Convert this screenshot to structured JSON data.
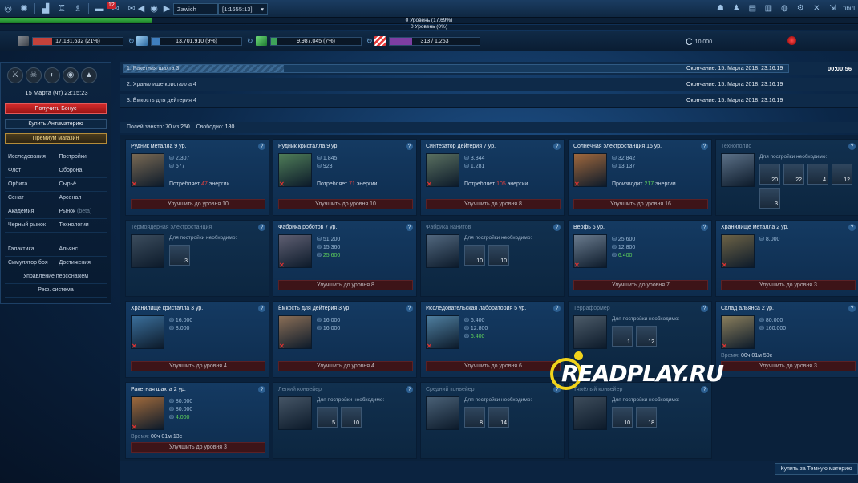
{
  "topbar": {
    "icons": [
      "rings-icon",
      "globe-icon",
      "chart-icon",
      "trophy-icon",
      "trophy-2-icon",
      "chat-icon",
      "mail-icon",
      "mail-2-icon"
    ],
    "mail_count": "12",
    "planet_name": "Zawich",
    "coords": "[1:1655:13]",
    "user": "fibirl"
  },
  "progress": {
    "level_line": "0 Уровень (17.69%)",
    "level_fraction": 0.177,
    "second_line": "0 Уровень (0%)"
  },
  "resources": [
    {
      "name": "Металл",
      "text": "17.181.632 (21%)",
      "fill": 0.21,
      "color": "#c3423b"
    },
    {
      "name": "Кристалл",
      "text": "13.701.910 (9%)",
      "fill": 0.09,
      "color": "#3f7fbf"
    },
    {
      "name": "Дейтерий",
      "text": "9.987.045 (7%)",
      "fill": 0.07,
      "color": "#3ea35a"
    },
    {
      "name": "Энергия",
      "text": "313 / 1.253",
      "fill": 0.25,
      "color": "#7d3ea3"
    }
  ],
  "antimatter": "10.000",
  "left": {
    "officers": [
      "sword-icon",
      "skull-icon",
      "shield-icon",
      "eye-icon",
      "rocket-icon"
    ],
    "datetime": "15 Марта (чт) 23:15:23",
    "bonus": "Получить Бонус",
    "buy_antimatter": "Купить Антиматерию",
    "premium": "Премиум магазин",
    "menu": [
      [
        "Исследования",
        "Постройки"
      ],
      [
        "Флот",
        "Оборона"
      ],
      [
        "Орбита",
        "Сырьё"
      ],
      [
        "Сенат",
        "Арсенал"
      ],
      [
        "Академия",
        "Рынок"
      ],
      [
        "Черный рынок",
        "Технологии"
      ]
    ],
    "beta": "(beta)",
    "menu2": [
      [
        "Галактика",
        "Альянс"
      ],
      [
        "Симулятор боя",
        "Достижения"
      ]
    ],
    "characters": "Управление персонажем",
    "referral": "Реф. система"
  },
  "queue": [
    {
      "name": "1. Ракетная шахта 3",
      "end": "Окончание: 15. Марта 2018, 23:16:19",
      "timer": "00:00:56",
      "progress": 0.24
    },
    {
      "name": "2. Хранилище кристалла 4",
      "end": "Окончание: 15. Марта 2018, 23:16:19",
      "timer": "",
      "progress": 0
    },
    {
      "name": "3. Ёмкость для дейтерия 4",
      "end": "Окончание: 15. Марта 2018, 23:16:19",
      "timer": "",
      "progress": 0
    }
  ],
  "fields": {
    "used_label": "Полей занято:",
    "used": "70",
    "of": "из",
    "total": "250",
    "free_label": "Свободно:",
    "free": "180"
  },
  "buildings": [
    {
      "title": "Рудник металла 9 ур.",
      "c1": "2.307",
      "c2": "577",
      "note_pre": "Потребляет",
      "note_val": "47",
      "note_post": "энергии",
      "note_color": "red",
      "upgrade": "Улучшить до уровня 10",
      "img": "#7a6a54"
    },
    {
      "title": "Рудник кристалла 9 ур.",
      "c1": "1.845",
      "c2": "923",
      "note_pre": "Потребляет",
      "note_val": "71",
      "note_post": "энергии",
      "note_color": "red",
      "upgrade": "Улучшить до уровня 10",
      "img": "#4f7d58"
    },
    {
      "title": "Синтезатор дейтерия 7 ур.",
      "c1": "3.844",
      "c2": "1.281",
      "note_pre": "Потребляет",
      "note_val": "105",
      "note_post": "энергии",
      "note_color": "red",
      "upgrade": "Улучшить до уровня 8",
      "img": "#5a7060"
    },
    {
      "title": "Солнечная электростанция 15 ур.",
      "c1": "32.842",
      "c2": "13.137",
      "note_pre": "Производит",
      "note_val": "217",
      "note_post": "энергии",
      "note_color": "green",
      "upgrade": "Улучшить до уровня 16",
      "img": "#a0683d"
    },
    {
      "title": "Технополис",
      "dim": true,
      "req_label": "Для постройки необходимо:",
      "reqs": [
        "20",
        "22",
        "4",
        "12",
        "3"
      ],
      "img": "#5c7188"
    },
    {
      "title": "Термоядерная электростанция",
      "dim": true,
      "req_label": "Для постройки необходимо:",
      "reqs": [
        "3"
      ],
      "img": "#3c4d5e"
    },
    {
      "title": "Фабрика роботов 7 ур.",
      "c1": "51.200",
      "c2": "15.360",
      "c3": "25.600",
      "upgrade": "Улучшить до уровня 8",
      "img": "#5f5f72"
    },
    {
      "title": "Фабрика нанитов",
      "dim": true,
      "req_label": "Для постройки необходимо:",
      "reqs": [
        "10",
        "10"
      ],
      "img": "#52687f"
    },
    {
      "title": "Верфь 6 ур.",
      "c1": "25.600",
      "c2": "12.800",
      "c3": "6.400",
      "upgrade": "Улучшить до уровня 7",
      "img": "#6a7b8e"
    },
    {
      "title": "Хранилище металла 2 ур.",
      "c1": "8.000",
      "upgrade": "Улучшить до уровня 3",
      "img": "#6d6346"
    },
    {
      "title": "Хранилище кристалла 3 ур.",
      "c1": "16.000",
      "c2": "8.000",
      "upgrade": "Улучшить до уровня 4",
      "img": "#3b6f9b"
    },
    {
      "title": "Ёмкость для дейтерия 3 ур.",
      "c1": "16.000",
      "c2": "16.000",
      "upgrade": "Улучшить до уровня 4",
      "img": "#8a6e56"
    },
    {
      "title": "Исследовательская лаборатория 5 ур.",
      "c1": "6.400",
      "c2": "12.800",
      "c3": "6.400",
      "upgrade": "Улучшить до уровня 6",
      "img": "#4f7fa0"
    },
    {
      "title": "Терраформер",
      "dim": true,
      "req_label": "Для постройки необходимо:",
      "reqs": [
        "1",
        "12"
      ],
      "img": "#4c5b69"
    },
    {
      "title": "Склад альянса 2 ур.",
      "c1": "80.000",
      "c2": "160.000",
      "timer_label": "Время:",
      "timer": "00ч 01м 50с",
      "upgrade": "Улучшить до уровня 3",
      "img": "#8a7e5c"
    },
    {
      "title": "Ракетная шахта 2 ур.",
      "c1": "80.000",
      "c2": "80.000",
      "c3": "4.000",
      "timer_label": "Время:",
      "timer": "00ч 01м 13с",
      "upgrade": "Улучшить до уровня 3",
      "img": "#a06a3c"
    },
    {
      "title": "Легкий конвейер",
      "dim": true,
      "req_label": "Для постройки необходимо:",
      "reqs": [
        "5",
        "10"
      ],
      "img": "#455566"
    },
    {
      "title": "Средний конвейер",
      "dim": true,
      "req_label": "Для постройки необходимо:",
      "reqs": [
        "8",
        "14"
      ],
      "img": "#4a6177"
    },
    {
      "title": "Тяжёлый конвейер",
      "dim": true,
      "req_label": "Для постройки необходимо:",
      "reqs": [
        "10",
        "18"
      ],
      "img": "#3d4c5b"
    }
  ],
  "footer": {
    "buy_dark_matter": "Купить за Темную материю"
  },
  "watermark": "READPLAY.RU"
}
